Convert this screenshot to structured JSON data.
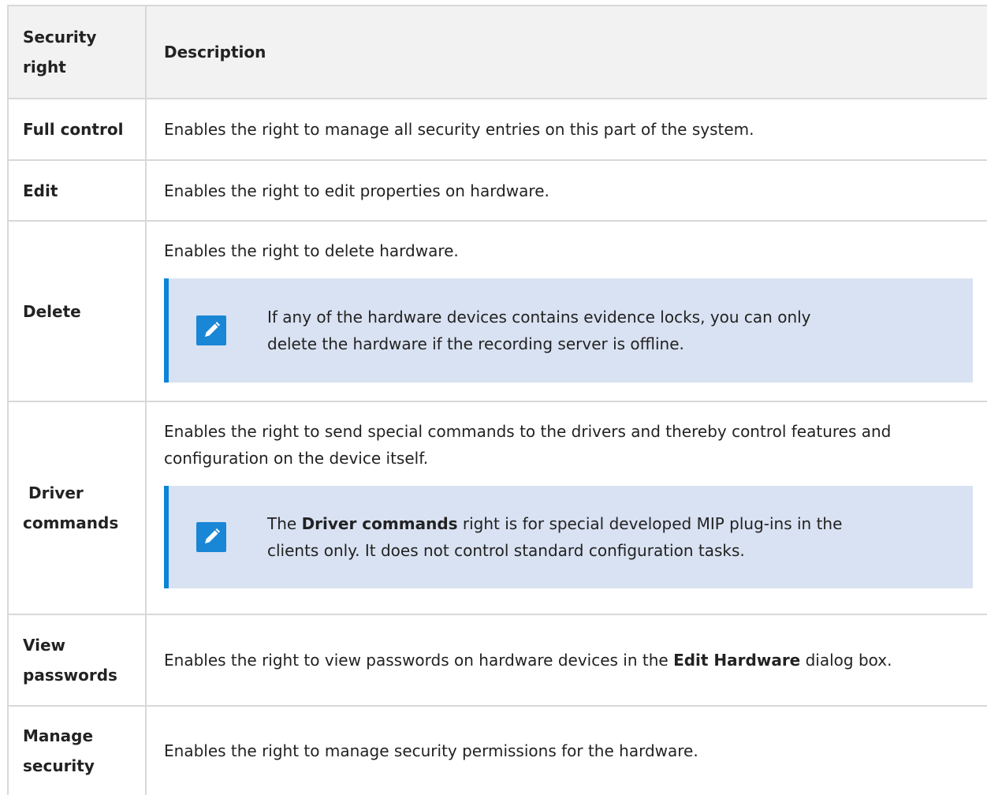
{
  "header": {
    "col1": "Security right",
    "col1_line1": "Security",
    "col1_line2": "right",
    "col2": "Description"
  },
  "rows": [
    {
      "name": "Full control",
      "description": "Enables the right to manage all security entries on this part of the system."
    },
    {
      "name": "Edit",
      "description": "Enables the right to edit properties on hardware."
    },
    {
      "name": "Delete",
      "description": "Enables the right to delete hardware.",
      "note_line1": "If any of the hardware devices contains evidence locks, you can only",
      "note_line2": "delete the hardware if the recording server is offline."
    },
    {
      "name": "Driver commands",
      "name_line1": "Driver",
      "name_line2": "commands",
      "description_line1": "Enables the right to send special commands to the drivers and thereby control features and",
      "description_line2": "configuration on the device itself.",
      "note_pre": "The ",
      "note_term": "Driver commands",
      "note_post": " right is for special developed MIP plug-ins in the",
      "note_line2": "clients only. It does not control standard configuration tasks."
    },
    {
      "name": "View passwords",
      "name_line1": "View",
      "name_line2": "passwords",
      "description_pre": "Enables the right to view passwords on hardware devices in the ",
      "description_term": "Edit Hardware",
      "description_post": " dialog box."
    },
    {
      "name": "Manage security",
      "name_line1": "Manage",
      "name_line2": "security",
      "description": "Enables the right to manage security permissions for the hardware."
    }
  ],
  "icons": {
    "note": "pencil-note-icon"
  },
  "colors": {
    "note_background": "#d9e2f2",
    "note_accent": "#0b84d8",
    "header_background": "#f2f2f2",
    "border": "#d8d8d8"
  }
}
